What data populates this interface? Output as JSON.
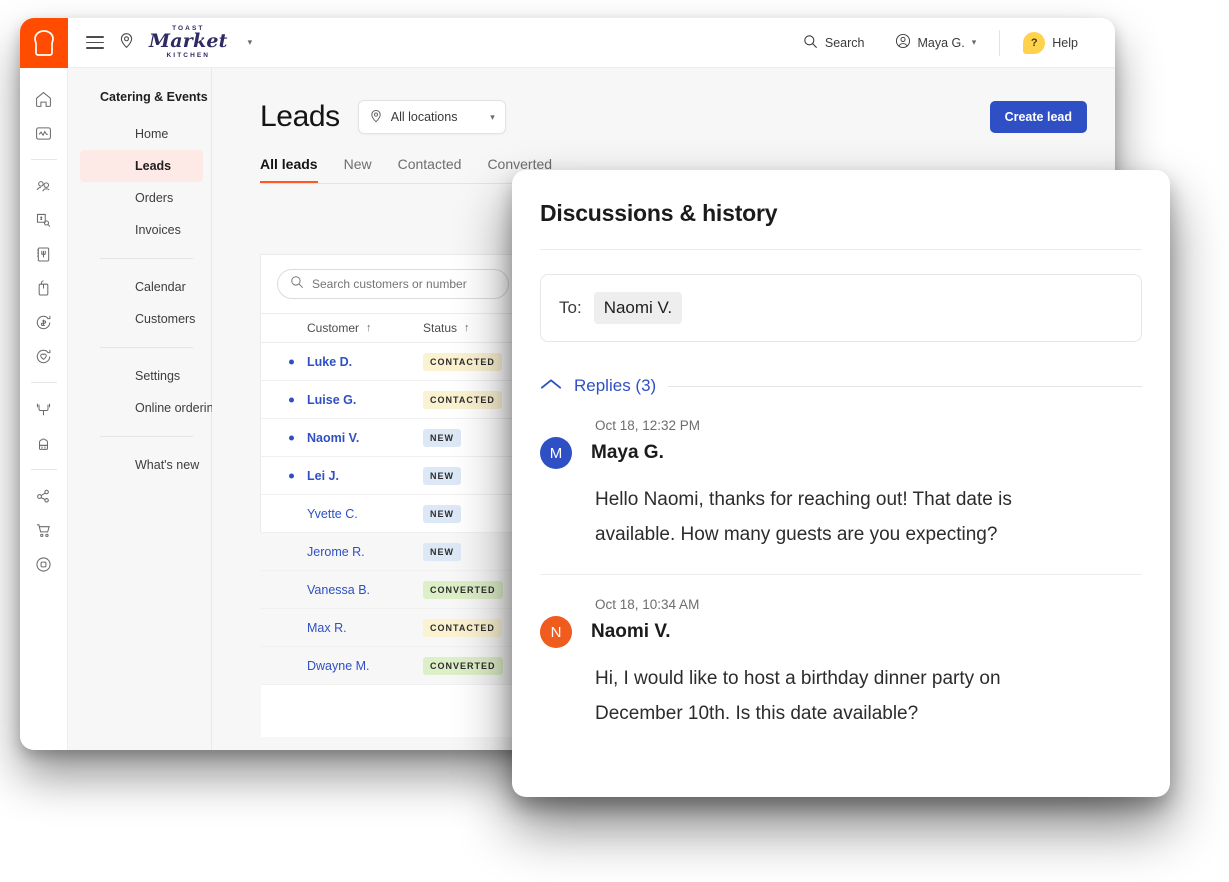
{
  "window": {
    "topbar": {
      "brand_icon": "toast-logo-icon",
      "menu_icon": "hamburger-menu-icon",
      "location_icon": "location-pin-icon",
      "logo_top": "TOAST",
      "logo_script": "Market",
      "logo_bottom": "KITCHEN",
      "logo_caret": "chevron-down-icon",
      "search_label": "Search",
      "user_label": "Maya G.",
      "help_label": "Help",
      "help_glyph": "?"
    },
    "rail": {
      "icons": [
        "home-icon",
        "analytics-icon",
        "guests-icon",
        "billing-icon",
        "menus-icon",
        "bag-icon",
        "payments-icon",
        "loyalty-icon",
        "table-service-icon",
        "kitchen-icon",
        "integrations-icon",
        "cart-icon",
        "device-icon"
      ]
    },
    "nav": {
      "title": "Catering & Events",
      "groups": [
        [
          "Home",
          "Leads",
          "Orders",
          "Invoices"
        ],
        [
          "Calendar",
          "Customers"
        ],
        [
          "Settings",
          "Online ordering"
        ],
        [
          "What's new"
        ]
      ],
      "active": "Leads"
    },
    "page": {
      "title": "Leads",
      "location_filter": "All locations",
      "create_button": "Create lead",
      "tabs": [
        {
          "label": "All leads",
          "active": true
        },
        {
          "label": "New",
          "active": false
        },
        {
          "label": "Contacted",
          "active": false
        },
        {
          "label": "Converted",
          "active": false
        }
      ],
      "search_placeholder": "Search customers or number",
      "calendar_icon": "calendar-icon",
      "columns": [
        {
          "label": "Customer",
          "sort": "↑"
        },
        {
          "label": "Status",
          "sort": "↑"
        }
      ],
      "rows": [
        {
          "customer": "Luke D.",
          "status": "CONTACTED",
          "tone": "contacted",
          "unread": true
        },
        {
          "customer": "Luise G.",
          "status": "CONTACTED",
          "tone": "contacted",
          "unread": true
        },
        {
          "customer": "Naomi V.",
          "status": "NEW",
          "tone": "new",
          "unread": true
        },
        {
          "customer": "Lei J.",
          "status": "NEW",
          "tone": "new",
          "unread": true
        },
        {
          "customer": "Yvette C.",
          "status": "NEW",
          "tone": "new",
          "unread": false
        },
        {
          "customer": "Jerome R.",
          "status": "NEW",
          "tone": "new",
          "unread": false
        },
        {
          "customer": "Vanessa B.",
          "status": "CONVERTED",
          "tone": "converted",
          "unread": false
        },
        {
          "customer": "Max R.",
          "status": "CONTACTED",
          "tone": "contacted",
          "unread": false
        },
        {
          "customer": "Dwayne M.",
          "status": "CONVERTED",
          "tone": "converted",
          "unread": false
        }
      ]
    }
  },
  "modal": {
    "title": "Discussions & history",
    "to_label": "To:",
    "to_value": "Naomi V.",
    "collapse_icon": "chevron-up-icon",
    "replies_label": "Replies (3)",
    "messages": [
      {
        "timestamp": "Oct 18, 12:32 PM",
        "author": "Maya G.",
        "initial": "M",
        "avatar_color": "#2f50c4",
        "body": "Hello Naomi, thanks for reaching out! That date is available. How many guests are you expecting?"
      },
      {
        "timestamp": "Oct 18, 10:34 AM",
        "author": "Naomi V.",
        "initial": "N",
        "avatar_color": "#f05b1e",
        "body": "Hi, I would like to host a birthday dinner party on December 10th. Is this date available?"
      }
    ]
  },
  "colors": {
    "brand_orange": "#ff4c00",
    "accent_blue": "#2f50c4",
    "tab_underline": "#ff5722",
    "active_nav_bg": "#fde9e6",
    "badge_contacted": "#fbf2d2",
    "badge_new": "#dde8f7",
    "badge_converted": "#ddefc7",
    "help_yellow": "#ffd24d"
  }
}
